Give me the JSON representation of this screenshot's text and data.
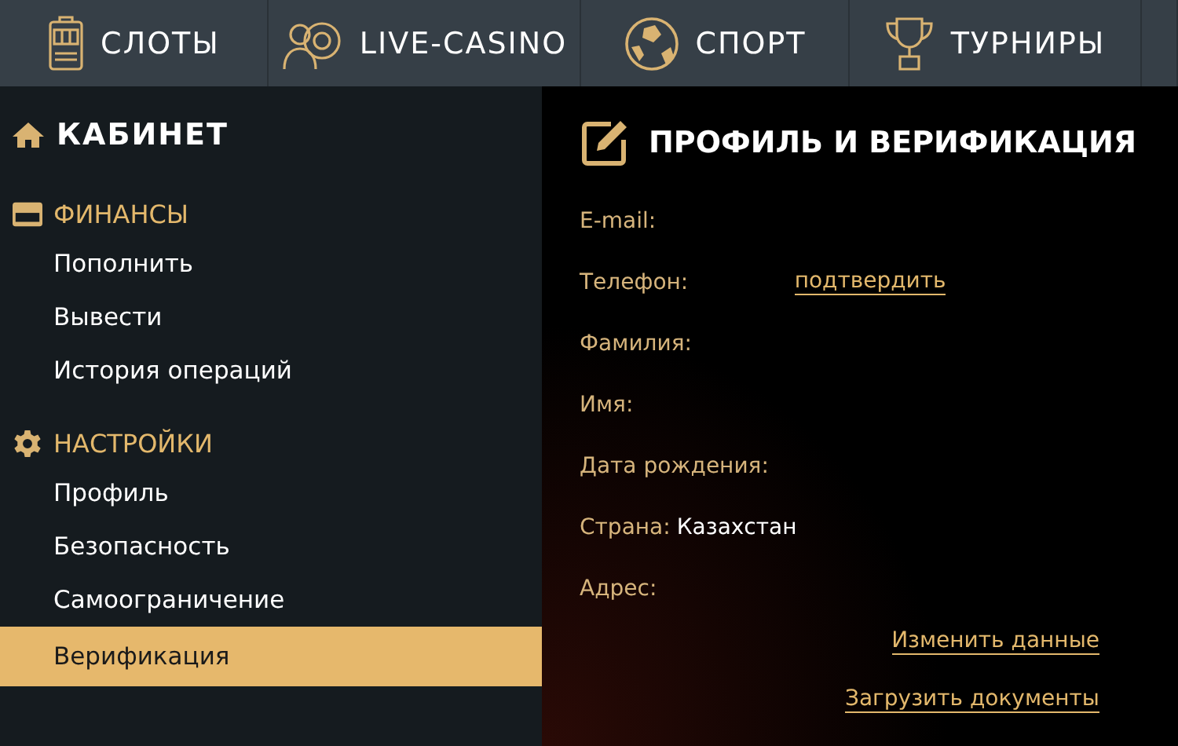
{
  "nav": [
    {
      "label": "СЛОТЫ",
      "kind": "slot"
    },
    {
      "label": "LIVE-CASINO",
      "kind": "dealer"
    },
    {
      "label": "СПОРТ",
      "kind": "ball"
    },
    {
      "label": "ТУРНИРЫ",
      "kind": "trophy"
    }
  ],
  "sidebar": {
    "title": "КАБИНЕТ",
    "sections": [
      {
        "title": "ФИНАНСЫ",
        "kind": "card",
        "items": [
          {
            "label": "Пополнить",
            "selected": false
          },
          {
            "label": "Вывести",
            "selected": false
          },
          {
            "label": "История операций",
            "selected": false
          }
        ]
      },
      {
        "title": "НАСТРОЙКИ",
        "kind": "gear",
        "items": [
          {
            "label": "Профиль",
            "selected": false
          },
          {
            "label": "Безопасность",
            "selected": false
          },
          {
            "label": "Самоограничение",
            "selected": false
          },
          {
            "label": "Верификация",
            "selected": true
          }
        ]
      }
    ]
  },
  "profile": {
    "title": "ПРОФИЛЬ И ВЕРИФИКАЦИЯ",
    "fields": [
      {
        "label": "E-mail:"
      },
      {
        "label": "Телефон:",
        "action": "подтвердить"
      },
      {
        "label": "Фамилия:"
      },
      {
        "label": "Имя:"
      },
      {
        "label": "Дата рождения:"
      },
      {
        "label": "Страна:",
        "value": "Казахстан"
      },
      {
        "label": "Адрес:"
      }
    ],
    "links": [
      "Изменить данные",
      "Загрузить документы"
    ]
  }
}
